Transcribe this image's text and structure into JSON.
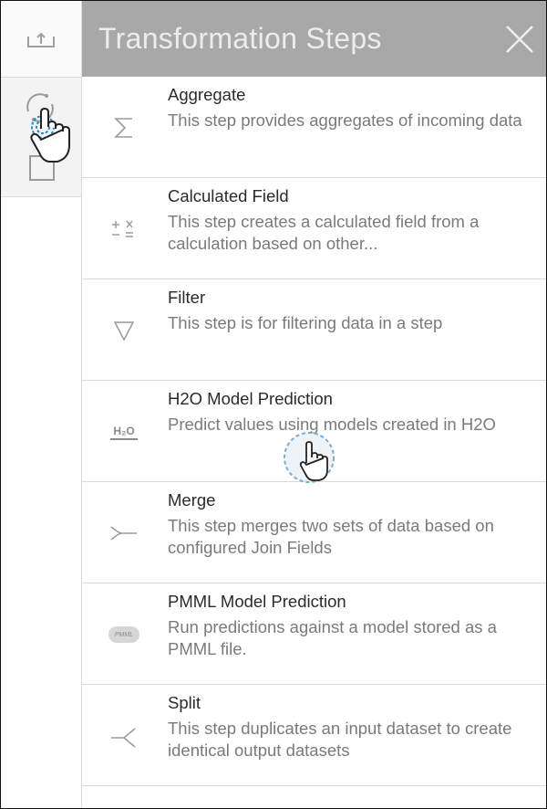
{
  "panel": {
    "title": "Transformation Steps"
  },
  "steps": [
    {
      "name": "Aggregate",
      "desc": "This step provides aggregates of incoming data",
      "icon": "sigma-icon"
    },
    {
      "name": "Calculated Field",
      "desc": "This step creates a calculated field from a calculation based on other...",
      "icon": "calculator-symbols-icon"
    },
    {
      "name": "Filter",
      "desc": "This step is for filtering data in a step",
      "icon": "funnel-icon"
    },
    {
      "name": "H2O Model Prediction",
      "desc": "Predict values using models created in H2O",
      "icon": "h2o-icon"
    },
    {
      "name": "Merge",
      "desc": "This step merges two sets of data based on configured Join Fields",
      "icon": "merge-icon"
    },
    {
      "name": "PMML Model Prediction",
      "desc": "Run predictions against a model stored as a PMML file.",
      "icon": "pmml-icon"
    },
    {
      "name": "Split",
      "desc": "This step duplicates an input dataset to create identical output datasets",
      "icon": "split-icon"
    }
  ],
  "icons": {
    "h2o_label": "H₂O",
    "pmml_label": "PMML"
  },
  "colors": {
    "header_bg": "#a8a8a8",
    "title_text": "#ececec",
    "icon_gray": "#9a9a9a",
    "cursor_ring": "#1a8fd1"
  }
}
